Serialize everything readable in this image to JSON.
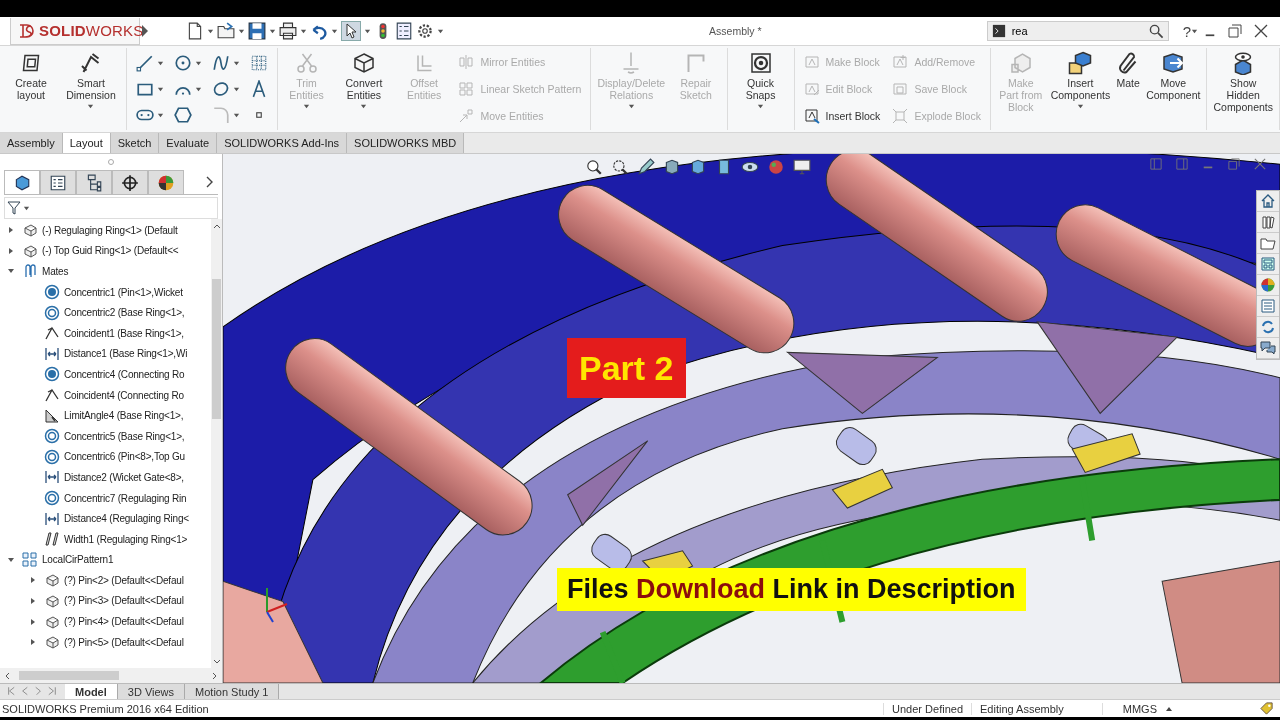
{
  "title_bar": {
    "logo": "**SOLID**WORKS",
    "title": "Assembly *",
    "search": {
      "value": "rea"
    },
    "help": "?"
  },
  "ribbon": {
    "groups": [
      {
        "items": [
          {
            "kind": "large",
            "label": "Create layout",
            "disabled": false,
            "dropdown": false
          },
          {
            "kind": "large",
            "label": "Smart Dimension",
            "disabled": false,
            "dropdown": true
          }
        ]
      },
      {
        "items": [
          {
            "kind": "palette"
          }
        ]
      },
      {
        "items": [
          {
            "kind": "large",
            "label": "Trim Entities",
            "disabled": true,
            "dropdown": true
          },
          {
            "kind": "large",
            "label": "Convert Entities",
            "disabled": false,
            "dropdown": true
          },
          {
            "kind": "large",
            "label": "Offset Entities",
            "disabled": true,
            "dropdown": false
          },
          {
            "kind": "stack",
            "entries": [
              {
                "label": "Mirror Entities",
                "disabled": true
              },
              {
                "label": "Linear Sketch Pattern",
                "disabled": true
              },
              {
                "label": "Move Entities",
                "disabled": true
              }
            ]
          }
        ]
      },
      {
        "items": [
          {
            "kind": "large",
            "label": "Display/Delete Relations",
            "disabled": true,
            "dropdown": true
          },
          {
            "kind": "large",
            "label": "Repair Sketch",
            "disabled": true,
            "dropdown": false
          }
        ]
      },
      {
        "items": [
          {
            "kind": "large",
            "label": "Quick Snaps",
            "disabled": false,
            "dropdown": true
          }
        ]
      },
      {
        "items": [
          {
            "kind": "stack",
            "entries": [
              {
                "label": "Make Block",
                "disabled": true
              },
              {
                "label": "Edit Block",
                "disabled": true
              },
              {
                "label": "Insert Block",
                "disabled": false
              }
            ]
          },
          {
            "kind": "stack",
            "entries": [
              {
                "label": "Add/Remove",
                "disabled": true
              },
              {
                "label": "Save Block",
                "disabled": true
              },
              {
                "label": "Explode Block",
                "disabled": true
              }
            ]
          }
        ]
      },
      {
        "items": [
          {
            "kind": "large",
            "label": "Make Part from Block",
            "disabled": true,
            "dropdown": false
          },
          {
            "kind": "large",
            "label": "Insert Components",
            "disabled": false,
            "dropdown": true
          },
          {
            "kind": "large",
            "label": "Mate",
            "disabled": false,
            "dropdown": false
          },
          {
            "kind": "large",
            "label": "Move Component",
            "disabled": false,
            "dropdown": false
          }
        ]
      },
      {
        "items": [
          {
            "kind": "large",
            "label": "Show Hidden Components",
            "disabled": false,
            "dropdown": false
          }
        ]
      }
    ]
  },
  "command_tabs": [
    {
      "label": "Assembly",
      "selected": false
    },
    {
      "label": "Layout",
      "selected": true
    },
    {
      "label": "Sketch",
      "selected": false
    },
    {
      "label": "Evaluate",
      "selected": false
    },
    {
      "label": "SOLIDWORKS Add-Ins",
      "selected": false
    },
    {
      "label": "SOLIDWORKS MBD",
      "selected": false
    }
  ],
  "panel_tabs": [
    {
      "selected": true
    },
    {
      "selected": false
    },
    {
      "selected": false
    },
    {
      "selected": false
    },
    {
      "selected": false
    }
  ],
  "feature_tree": [
    {
      "kind": "component",
      "label": "(-) Regulaging Ring<1> (Default",
      "expanded": false
    },
    {
      "kind": "component",
      "label": "(-) Top Guid Ring<1> (Default<<",
      "expanded": false
    },
    {
      "kind": "mates",
      "label": "Mates",
      "expanded": true,
      "children": [
        {
          "kind": "concentric_solid",
          "label": "Concentric1 (Pin<1>,Wicket"
        },
        {
          "kind": "concentric",
          "label": "Concentric2 (Base Ring<1>,"
        },
        {
          "kind": "coincident",
          "label": "Coincident1 (Base Ring<1>,"
        },
        {
          "kind": "distance",
          "label": "Distance1 (Base Ring<1>,Wi"
        },
        {
          "kind": "concentric_solid",
          "label": "Concentric4 (Connecting Ro"
        },
        {
          "kind": "coincident",
          "label": "Coincident4 (Connecting Ro"
        },
        {
          "kind": "limit_angle",
          "label": "LimitAngle4 (Base Ring<1>,"
        },
        {
          "kind": "concentric",
          "label": "Concentric5 (Base Ring<1>,"
        },
        {
          "kind": "concentric",
          "label": "Concentric6 (Pin<8>,Top Gu"
        },
        {
          "kind": "distance",
          "label": "Distance2 (Wicket Gate<8>,"
        },
        {
          "kind": "concentric",
          "label": "Concentric7 (Regulaging Rin"
        },
        {
          "kind": "distance",
          "label": "Distance4 (Regulaging Ring<"
        },
        {
          "kind": "width",
          "label": "Width1 (Regulaging Ring<1>"
        }
      ]
    },
    {
      "kind": "pattern",
      "label": "LocalCirPattern1",
      "expanded": true,
      "children": [
        {
          "kind": "component",
          "label": "(?) Pin<2> (Default<<Defaul",
          "expanded": false
        },
        {
          "kind": "component",
          "label": "(?) Pin<3> (Default<<Defaul",
          "expanded": false
        },
        {
          "kind": "component",
          "label": "(?) Pin<4> (Default<<Defaul",
          "expanded": false
        },
        {
          "kind": "component",
          "label": "(?) Pin<5> (Default<<Defaul",
          "expanded": false
        }
      ]
    }
  ],
  "viewport": {
    "part_label": "Part 2",
    "banner": "Files **Download** Link in Description"
  },
  "bottom_tabs": [
    {
      "label": "Model",
      "selected": true
    },
    {
      "label": "3D Views",
      "selected": false
    },
    {
      "label": "Motion Study 1",
      "selected": false
    }
  ],
  "status_bar": {
    "edition": "SOLIDWORKS Premium 2016 x64 Edition",
    "state": "Under Defined",
    "mode": "Editing Assembly",
    "units": "MMGS"
  }
}
